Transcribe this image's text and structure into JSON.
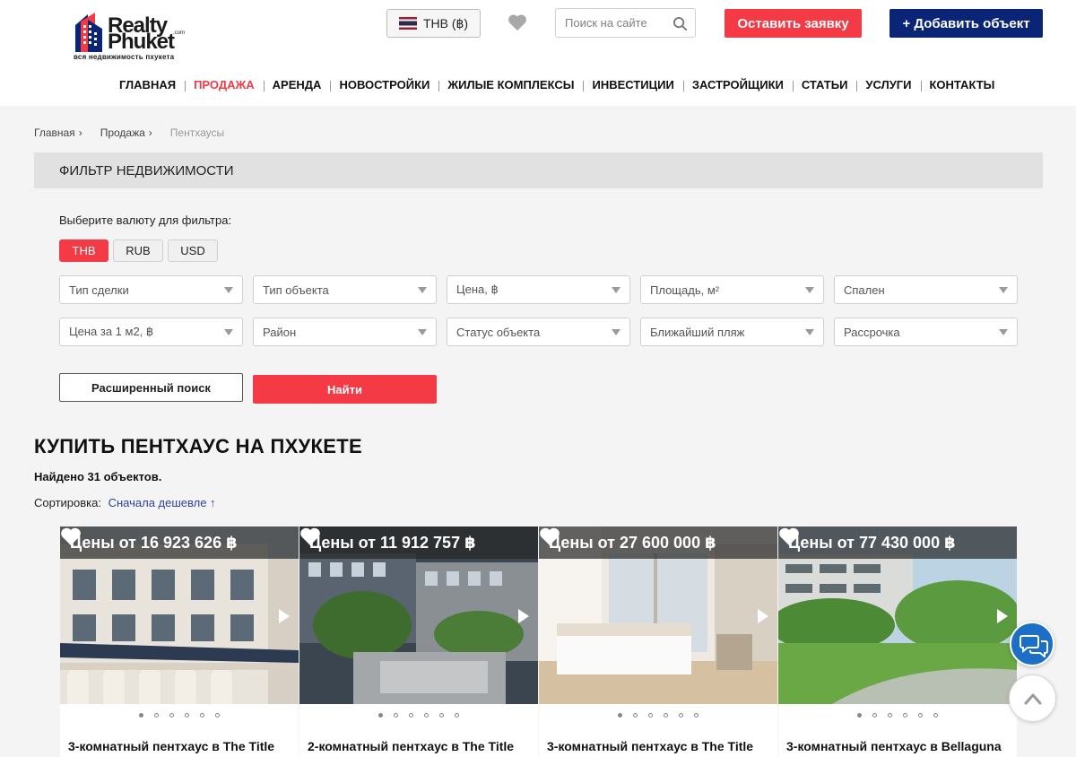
{
  "logo": {
    "word1": "Realty",
    "word2": "Phuket",
    "com": ".com",
    "tagline": "вся недвижимость пхукета"
  },
  "header": {
    "currency_label": "THB (฿)",
    "search_placeholder": "Поиск на сайте",
    "request_button": "Оставить заявку",
    "add_button": "+ Добавить объект"
  },
  "nav": [
    {
      "label": "ГЛАВНАЯ",
      "active": false
    },
    {
      "label": "ПРОДАЖА",
      "active": true
    },
    {
      "label": "АРЕНДА",
      "active": false
    },
    {
      "label": "НОВОСТРОЙКИ",
      "active": false
    },
    {
      "label": "ЖИЛЫЕ КОМПЛЕКСЫ",
      "active": false
    },
    {
      "label": "ИНВЕСТИЦИИ",
      "active": false
    },
    {
      "label": "ЗАСТРОЙЩИКИ",
      "active": false
    },
    {
      "label": "СТАТЬИ",
      "active": false
    },
    {
      "label": "УСЛУГИ",
      "active": false
    },
    {
      "label": "КОНТАКТЫ",
      "active": false
    }
  ],
  "breadcrumb": [
    {
      "label": "Главная",
      "sep": "›"
    },
    {
      "label": "Продажа",
      "sep": "›"
    },
    {
      "label": "Пентхаусы",
      "sep": ""
    }
  ],
  "filter": {
    "title": "ФИЛЬТР НЕДВИЖИМОСТИ",
    "currency_label": "Выберите валюту для фильтра:",
    "currencies": [
      {
        "label": "THB",
        "active": true
      },
      {
        "label": "RUB",
        "active": false
      },
      {
        "label": "USD",
        "active": false
      }
    ],
    "row1": [
      "Тип сделки",
      "Тип объекта",
      "Цена, ฿",
      "Площадь, м²",
      "Спален"
    ],
    "row2": [
      "Цена за 1 м2, ฿",
      "Район",
      "Статус объекта",
      "Ближайший пляж",
      "Рассрочка"
    ],
    "advanced_button": "Расширенный поиск",
    "find_button": "Найти"
  },
  "results": {
    "title": "КУПИТЬ ПЕНТХАУС НА ПХУКЕТЕ",
    "found": "Найдено 31 объектов.",
    "sort_label": "Сортировка:",
    "sort_value": "Сначала дешевле ↑"
  },
  "cards": [
    {
      "price": "Цены от 16 923 626 ฿",
      "title": "3-комнатный пентхаус в The Title",
      "active_dot": 0
    },
    {
      "price": "Цены от 11 912 757 ฿",
      "title": "2-комнатный пентхаус в The Title",
      "active_dot": 0
    },
    {
      "price": "Цены от 27 600 000 ฿",
      "title": "3-комнатный пентхаус в The Title",
      "active_dot": 0
    },
    {
      "price": "Цены от 77 430 000 ฿",
      "title": "3-комнатный пентхаус в Bellaguna",
      "active_dot": 0
    }
  ],
  "colors": {
    "accent_red": "#f43a44",
    "navy": "#0a2575",
    "chat_blue": "#1b6fc6"
  }
}
